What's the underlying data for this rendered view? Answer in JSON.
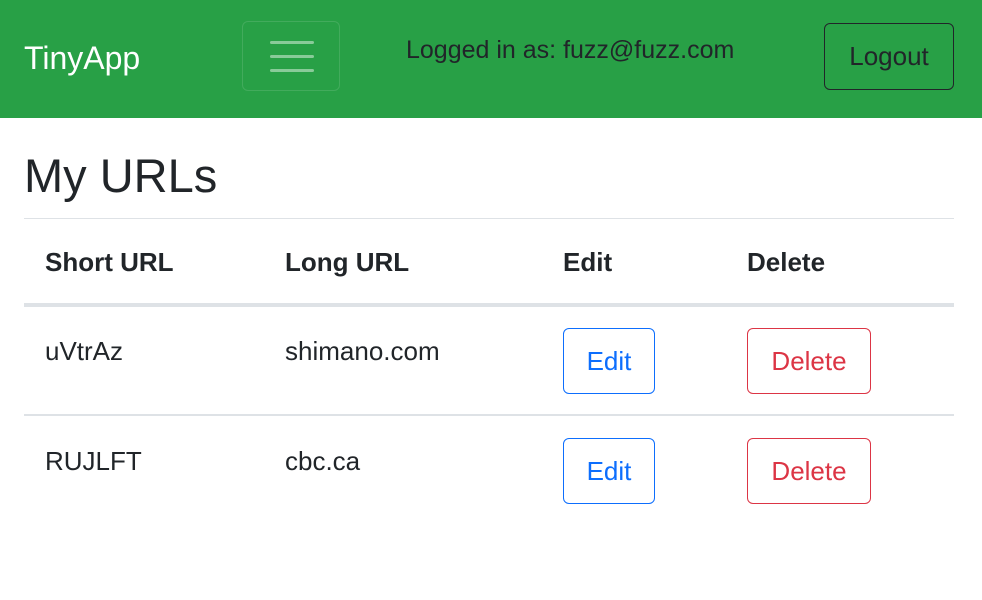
{
  "navbar": {
    "brand": "TinyApp",
    "logged_in_text": "Logged in as: fuzz@fuzz.com",
    "logout_label": "Logout"
  },
  "main": {
    "title": "My URLs",
    "table": {
      "headers": [
        "Short URL",
        "Long URL",
        "Edit",
        "Delete"
      ],
      "rows": [
        {
          "short_url": "uVtrAz",
          "long_url": "shimano.com",
          "edit_label": "Edit",
          "delete_label": "Delete"
        },
        {
          "short_url": "RUJLFT",
          "long_url": "cbc.ca",
          "edit_label": "Edit",
          "delete_label": "Delete"
        }
      ]
    }
  },
  "colors": {
    "navbar_bg": "#28a046",
    "edit_accent": "#0d6efd",
    "delete_accent": "#dc3545"
  },
  "icons": {
    "menu_toggle": "hamburger-menu-icon"
  }
}
